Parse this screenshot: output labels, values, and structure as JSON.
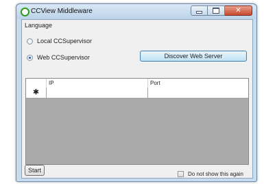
{
  "window": {
    "title": "CCView Middleware",
    "close_glyph": "✕"
  },
  "menu": {
    "items": [
      "Language"
    ]
  },
  "options": {
    "local_label": "Local CCSupervisor",
    "web_label": "Web CCSupervisor",
    "selected": "web"
  },
  "discover_button": {
    "label": "Discover Web Server"
  },
  "grid": {
    "columns": [
      "",
      "IP",
      "Port"
    ],
    "new_row_marker": "✱",
    "rows": [
      {
        "ip": "",
        "port": ""
      }
    ]
  },
  "dont_show_again": {
    "label": "Do not show this again",
    "checked": false
  },
  "start_button": {
    "label": "Start"
  }
}
